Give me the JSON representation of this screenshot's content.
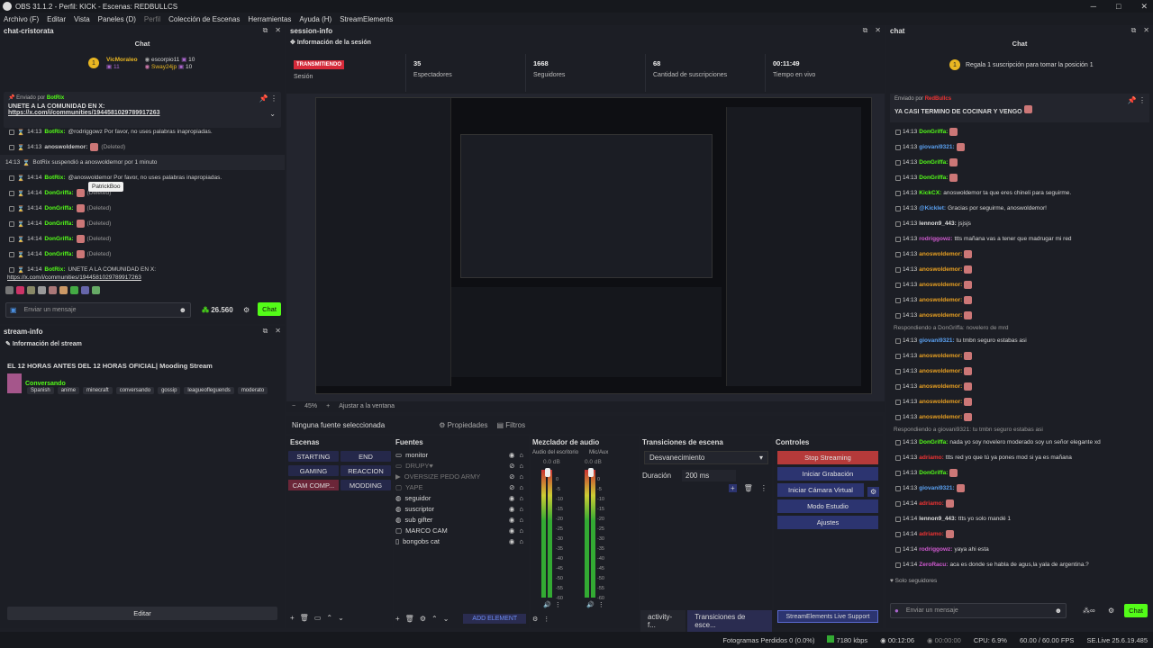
{
  "app": {
    "title": "OBS 31.1.2 - Perfil: KICK - Escenas: REDBULLCS",
    "window_controls": [
      "─",
      "□",
      "✕"
    ]
  },
  "menu": [
    "Archivo (F)",
    "Editar",
    "Vista",
    "Paneles (D)",
    "Perfil",
    "Colección de Escenas",
    "Herramientas",
    "Ayuda (H)",
    "StreamElements"
  ],
  "left_chat": {
    "dock_title": "chat-cristorata",
    "title": "Chat",
    "leaders": [
      {
        "rank": "1",
        "name": "VicMoraleo",
        "count": "11"
      },
      {
        "name": "escorpio11",
        "count": "10"
      },
      {
        "name": "Sway24jp",
        "count": "10"
      }
    ],
    "pinned": {
      "from": "Enviado por",
      "user": "BotRix",
      "text": "UNETE A LA COMUNIDAD EN X:",
      "link": "https://x.com/i/communities/1944581029789917263"
    },
    "messages": [
      {
        "time": "14:13",
        "user": "BotRix:",
        "text": "@rodriggowz Por favor, no uses palabras inapropiadas."
      },
      {
        "time": "14:13",
        "user": "anoswoldemor:",
        "text": "(Deleted)"
      },
      {
        "time": "14:13",
        "user": "",
        "text": "BotRix suspendió a anoswoldemor por 1 minuto"
      },
      {
        "time": "14:14",
        "user": "BotRix:",
        "text": "@anoswoldemor Por favor, no uses palabras inapropiadas."
      },
      {
        "time": "14:14",
        "user": "DonGriffa:",
        "text": "(Deleted)"
      },
      {
        "time": "14:14",
        "user": "DonGriffa:",
        "text": "(Deleted)"
      },
      {
        "time": "14:14",
        "user": "DonGriffa:",
        "text": "(Deleted)"
      },
      {
        "time": "14:14",
        "user": "DonGriffa:",
        "text": "(Deleted)"
      },
      {
        "time": "14:14",
        "user": "DonGriffa:",
        "text": "(Deleted)"
      },
      {
        "time": "14:14",
        "user": "BotRix:",
        "text": "UNETE A LA COMUNIDAD EN X:"
      }
    ],
    "last_link": "https://x.com/i/communities/1944581029789917263",
    "tooltip": "PatrickBoo",
    "input_placeholder": "Enviar un mensaje",
    "points": "26.560",
    "send": "Chat"
  },
  "stream_info": {
    "dock_title": "stream-info",
    "header": "Información del stream",
    "title": "EL 12 HORAS ANTES DEL 12 HORAS OFICIAL| Mooding Stream",
    "category": "Conversando",
    "tags": [
      "Spanish",
      "anime",
      "minecraft",
      "conversando",
      "gossip",
      "leagueofleguends",
      "moderato"
    ],
    "edit": "Editar"
  },
  "session": {
    "dock_title": "session-info",
    "header": "Información de la sesión",
    "stats": [
      {
        "val": "TRANSMITIENDO",
        "lbl": "Sesión"
      },
      {
        "val": "35",
        "lbl": "Espectadores"
      },
      {
        "val": "1668",
        "lbl": "Seguidores"
      },
      {
        "val": "68",
        "lbl": "Cantidad de suscripciones"
      },
      {
        "val": "00:11:49",
        "lbl": "Tiempo en vivo"
      }
    ]
  },
  "preview": {
    "zoom": "45%",
    "fit": "Ajustar a la ventana"
  },
  "source_bar": {
    "none": "Ninguna fuente seleccionada",
    "props": "Propiedades",
    "filters": "Filtros"
  },
  "scenes": {
    "title": "Escenas",
    "items": [
      "STARTING",
      "END",
      "GAMING",
      "REACCION",
      "CAM COMP...",
      "MODDING"
    ]
  },
  "sources": {
    "title": "Fuentes",
    "items": [
      "monitor",
      "DRUPY♥",
      "OVERSIZE PEDO ARMY",
      "YAPE",
      "seguidor",
      "suscriptor",
      "sub gifter",
      "MARCO CAM",
      "bongobs cat"
    ],
    "add": "ADD ELEMENT"
  },
  "mixer": {
    "title": "Mezclador de audio",
    "ch1": "Audio del escritorio",
    "ch2": "Mic/Aux",
    "db1": "0.0 dB",
    "db2": "0.0 dB",
    "scale": [
      "0",
      "-5",
      "-10",
      "-15",
      "-20",
      "-25",
      "-30",
      "-35",
      "-40",
      "-45",
      "-50",
      "-55",
      "-60"
    ]
  },
  "transitions": {
    "title": "Transiciones de escena",
    "type": "Desvanecimiento",
    "dur_lbl": "Duración",
    "dur": "200 ms",
    "tabs": [
      "activity-f...",
      "Transiciones de esce..."
    ]
  },
  "controls": {
    "title": "Controles",
    "buttons": [
      "Stop Streaming",
      "Iniciar Grabación",
      "Iniciar Cámara Virtual",
      "Modo Estudio",
      "Ajustes"
    ],
    "se": "StreamElements Live Support"
  },
  "right_chat": {
    "dock_title": "chat",
    "title": "Chat",
    "gift": "Regala 1 suscripción para tomar la posición 1",
    "pinned": {
      "from": "Enviado por",
      "user": "RedBullcs",
      "text": "YA CASI TERMINO DE COCINAR Y VENGO"
    },
    "messages": [
      {
        "time": "14:13",
        "user": "DonGriffa:",
        "text": ""
      },
      {
        "time": "14:13",
        "user": "giovani9321:",
        "text": ""
      },
      {
        "time": "14:13",
        "user": "DonGriffa:",
        "text": ""
      },
      {
        "time": "14:13",
        "user": "DonGriffa:",
        "text": ""
      },
      {
        "time": "14:13",
        "user": "KickCX:",
        "text": "anoswoldemor ta que eres chineli para seguirme."
      },
      {
        "time": "14:13",
        "user": "@Kicklet:",
        "text": "Gracias por seguirme, anoswoldemor!"
      },
      {
        "time": "14:13",
        "user": "lennon9_443:",
        "text": "jsjsjs"
      },
      {
        "time": "14:13",
        "user": "rodriggowz:",
        "text": "ttts mañana vas a tener que madrugar mi red"
      },
      {
        "time": "14:13",
        "user": "anoswoldemor:",
        "text": ""
      },
      {
        "time": "14:13",
        "user": "anoswoldemor:",
        "text": ""
      },
      {
        "time": "14:13",
        "user": "anoswoldemor:",
        "text": ""
      },
      {
        "time": "14:13",
        "user": "anoswoldemor:",
        "text": ""
      },
      {
        "time": "14:13",
        "user": "anoswoldemor:",
        "text": ""
      },
      {
        "time": "",
        "user": "",
        "text": "Respondiendo a DonGriffa: novelero de mrd"
      },
      {
        "time": "14:13",
        "user": "giovani9321:",
        "text": "tu tmbn seguro estabas asi"
      },
      {
        "time": "14:13",
        "user": "anoswoldemor:",
        "text": ""
      },
      {
        "time": "14:13",
        "user": "anoswoldemor:",
        "text": ""
      },
      {
        "time": "14:13",
        "user": "anoswoldemor:",
        "text": ""
      },
      {
        "time": "14:13",
        "user": "anoswoldemor:",
        "text": ""
      },
      {
        "time": "14:13",
        "user": "anoswoldemor:",
        "text": ""
      },
      {
        "time": "",
        "user": "",
        "text": "Respondiendo a giovani9321: tu tmbn seguro estabas asi"
      },
      {
        "time": "14:13",
        "user": "DonGriffa:",
        "text": "nada yo soy novelero moderado soy un señor elegante xd"
      },
      {
        "time": "14:13",
        "user": "adriamo:",
        "text": "ttts red yo que tú ya pones mod si ya es mañana"
      },
      {
        "time": "14:13",
        "user": "DonGriffa:",
        "text": ""
      },
      {
        "time": "14:13",
        "user": "giovani9321:",
        "text": ""
      },
      {
        "time": "14:14",
        "user": "adriamo:",
        "text": ""
      },
      {
        "time": "14:14",
        "user": "lennon9_443:",
        "text": "ttts yo solo mandé 1"
      },
      {
        "time": "14:14",
        "user": "adriamo:",
        "text": ""
      },
      {
        "time": "14:14",
        "user": "rodriggowz:",
        "text": "yaya ahi esta"
      },
      {
        "time": "14:14",
        "user": "ZeroRacu:",
        "text": "aca es donde se habla de agus,la yala de argentina.?"
      }
    ],
    "followers_only": "Solo seguidores",
    "input_placeholder": "Enviar un mensaje",
    "send": "Chat"
  },
  "status": {
    "dropped": "Fotogramas Perdidos 0 (0.0%)",
    "kbps": "7180 kbps",
    "rec": "00:12:06",
    "rec2": "00:00:00",
    "cpu": "CPU: 6.9%",
    "fps": "60.00 / 60.00 FPS",
    "ver": "SE.Live 25.6.19.485"
  }
}
